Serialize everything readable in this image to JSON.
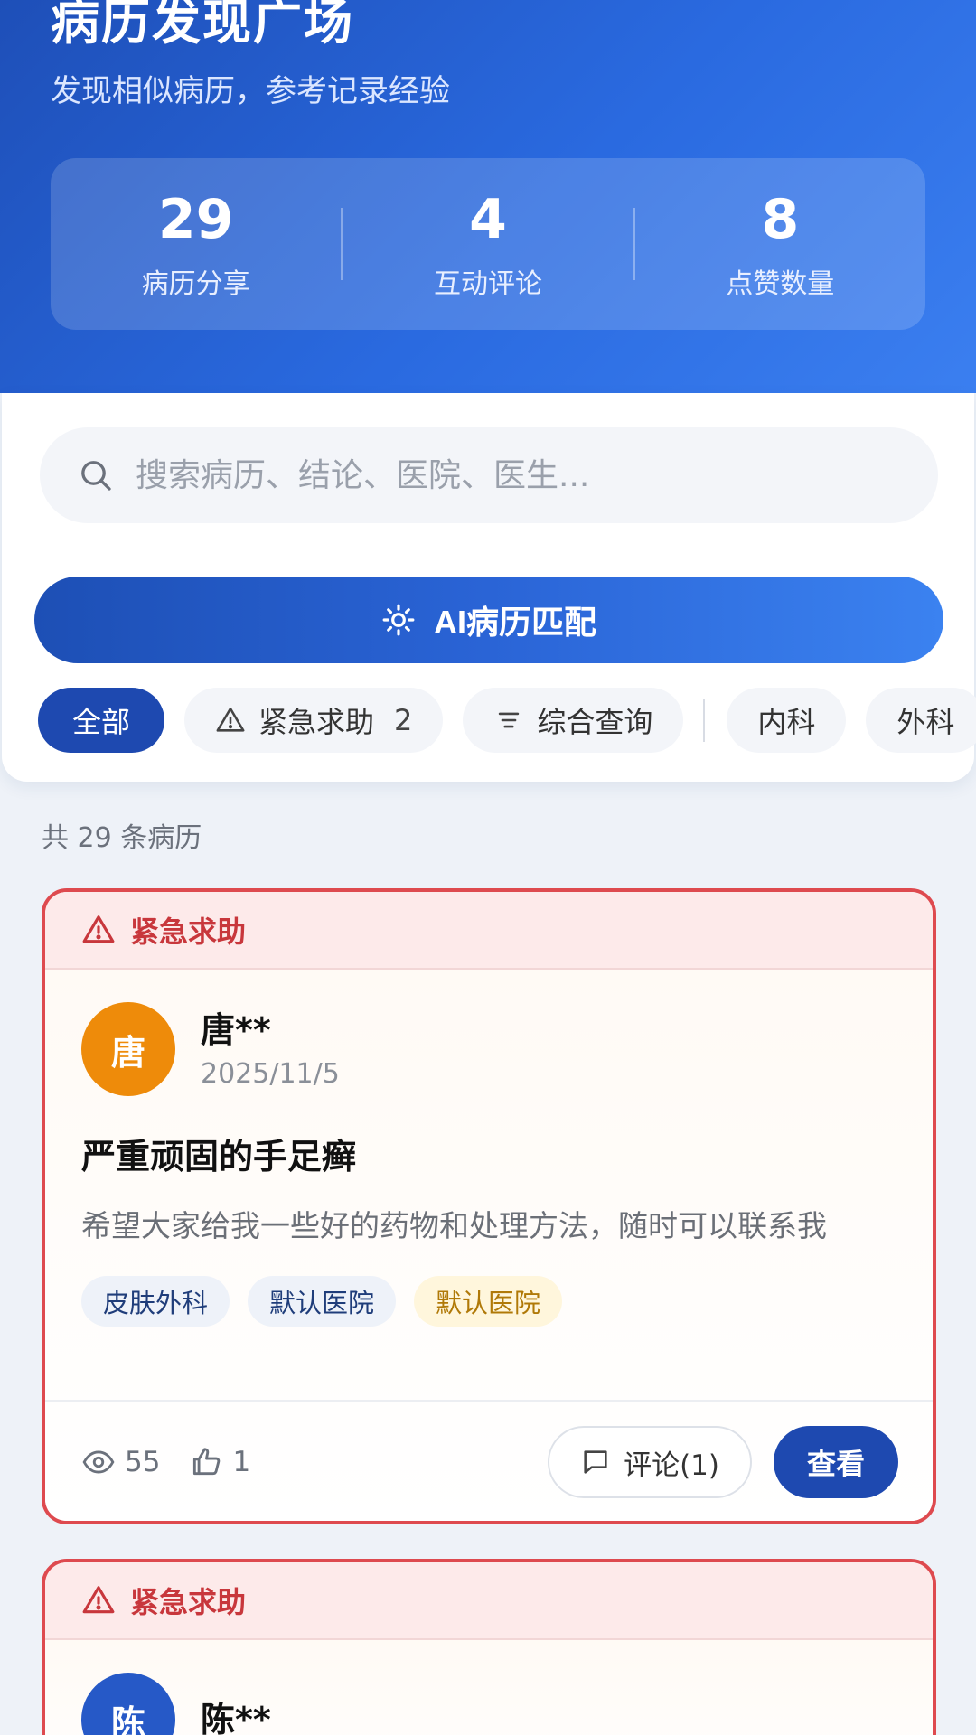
{
  "header": {
    "title": "病历发现广场",
    "subtitle": "发现相似病历，参考记录经验"
  },
  "stats": [
    {
      "value": "29",
      "label": "病历分享"
    },
    {
      "value": "4",
      "label": "互动评论"
    },
    {
      "value": "8",
      "label": "点赞数量"
    }
  ],
  "search": {
    "placeholder": "搜索病历、结论、医院、医生..."
  },
  "ai_match": {
    "label": "AI病历匹配"
  },
  "filters": {
    "all": "全部",
    "urgent": "紧急求助",
    "urgent_count": "2",
    "combined": "综合查询",
    "internal": "内科",
    "surgery": "外科"
  },
  "list": {
    "count_text": "共 29 条病历"
  },
  "cases": [
    {
      "badge": "紧急求助",
      "avatar": "唐",
      "author": "唐**",
      "date": "2025/11/5",
      "title": "严重顽固的手足癣",
      "desc": "希望大家给我一些好的药物和处理方法，随时可以联系我",
      "tags": [
        "皮肤外科",
        "默认医院",
        "默认医院"
      ],
      "views": "55",
      "likes": "1",
      "comment_label": "评论(1)",
      "view_label": "查看"
    },
    {
      "badge": "紧急求助",
      "avatar": "陈",
      "author": "陈**"
    }
  ],
  "colors": {
    "primary": "#1e49b0",
    "urgent": "#de4a4f",
    "avatar_orange": "#ee8b0a",
    "avatar_blue": "#2659c7"
  }
}
